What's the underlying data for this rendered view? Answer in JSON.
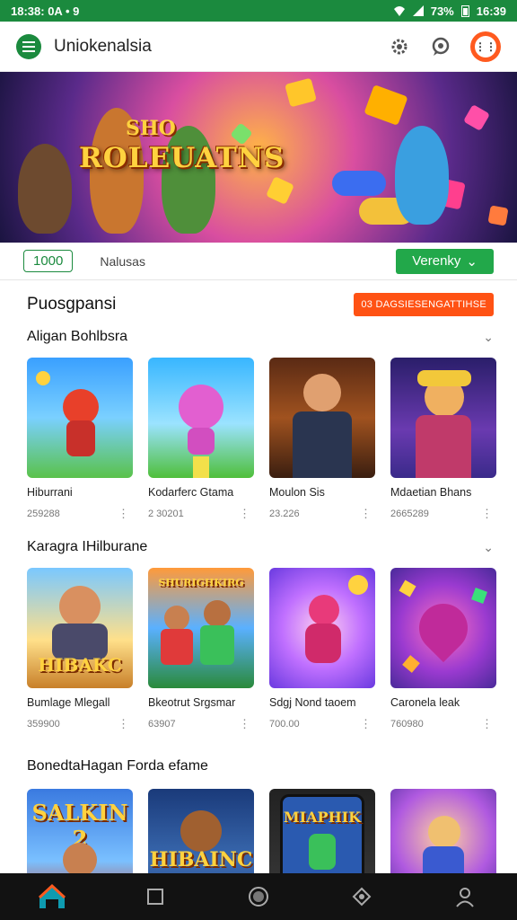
{
  "status_bar": {
    "left": "18:38: 0A • 9",
    "battery": "73%",
    "time": "16:39"
  },
  "app_bar": {
    "title": "Uniokenalsia",
    "menu_icon": "menu-icon",
    "settings_icon": "gear-icon",
    "chat_icon": "chat-icon",
    "avatar_icon": "avatar-icon"
  },
  "banner": {
    "logo_small": "SHO",
    "logo_main": "ROLEUATNS"
  },
  "filter": {
    "chip_label": "1000",
    "label": "Nalusas",
    "button_label": "Verenky"
  },
  "promo": {
    "title": "Puosgpansi",
    "button_label": "03 DAGSIESENGATTIHSE"
  },
  "sections": [
    {
      "title": "Aligan Bohlbsra",
      "items": [
        {
          "title": "Hiburrani",
          "meta": "259288"
        },
        {
          "title": "Kodarferc Gtama",
          "meta": "2 30201"
        },
        {
          "title": "Moulon Sis",
          "meta": "23.226"
        },
        {
          "title": "Mdaetian Bhans",
          "meta": "2665289"
        }
      ]
    },
    {
      "title": "Karagra IHilburane",
      "items": [
        {
          "title": "Bumlage Mlegall",
          "meta": "359900"
        },
        {
          "title": "Bkeotrut Srgsmar",
          "meta": "63907"
        },
        {
          "title": "Sdgj Nond taoem",
          "meta": "700.00"
        },
        {
          "title": "Caronela leak",
          "meta": "760980"
        }
      ]
    },
    {
      "title": "BonedtaHagan Forda efame",
      "items": [
        {
          "title": "SALKIN 2",
          "meta": ""
        },
        {
          "title": "HIBAINC",
          "meta": ""
        },
        {
          "title": "MIAPHIK",
          "meta": ""
        },
        {
          "title": "",
          "meta": ""
        }
      ]
    }
  ],
  "thumb_texts": {
    "s1_0": "HIBAKC",
    "s1_1": "SHURIGHKIRG",
    "s2_0": "SALKIN 2",
    "s2_1": "HIBAINC",
    "s2_2": "MIAPHIK"
  },
  "bottom_nav": [
    "home-icon",
    "square-icon",
    "circle-icon",
    "diamond-icon",
    "profile-icon"
  ],
  "colors": {
    "brand_green": "#1b8a3e",
    "accent_orange": "#ff5214",
    "button_green": "#22a84a"
  }
}
